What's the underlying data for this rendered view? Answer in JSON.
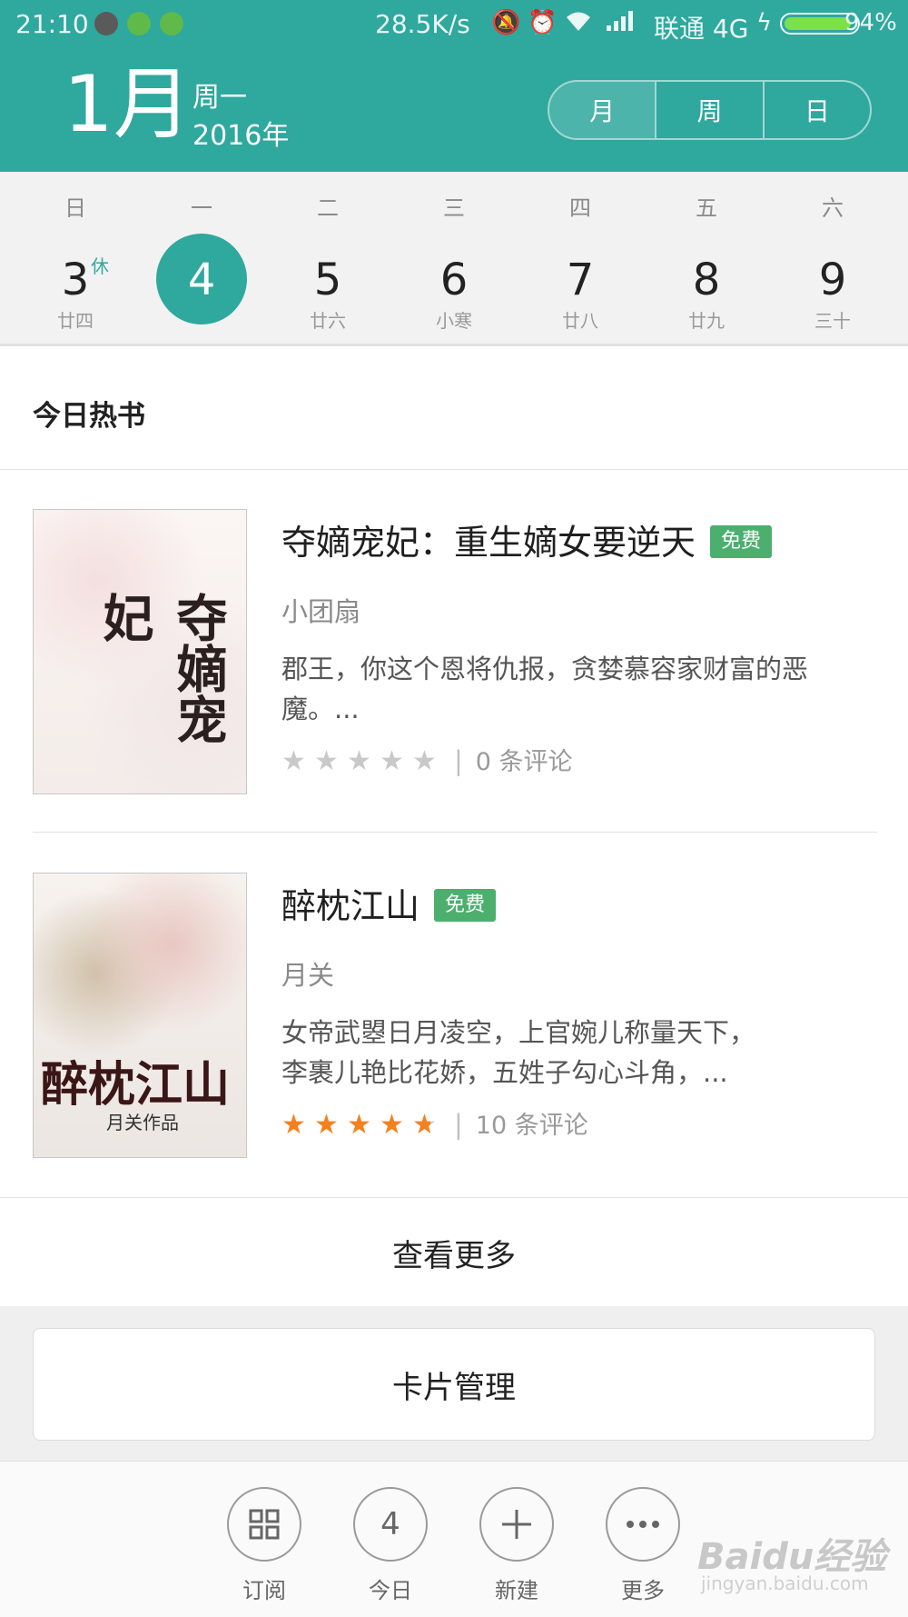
{
  "status_bar": {
    "time": "21:10",
    "speed": "28.5K/s",
    "carrier": "联通 4G",
    "battery": "94%",
    "battery_level": 0.94,
    "icons": [
      "mute-icon",
      "alarm-icon",
      "wifi-icon",
      "signal-icon",
      "charging-icon"
    ]
  },
  "header": {
    "month": "1月",
    "weekday": "周一",
    "year": "2016年",
    "view_tabs": [
      "月",
      "周",
      "日"
    ],
    "accent_color": "#2fa89e"
  },
  "week": {
    "weekday_labels": [
      "日",
      "一",
      "二",
      "三",
      "四",
      "五",
      "六"
    ],
    "days": [
      {
        "num": "3",
        "sub": "廿四",
        "tag": "休"
      },
      {
        "num": "4",
        "sub": "",
        "selected": true
      },
      {
        "num": "5",
        "sub": "廿六"
      },
      {
        "num": "6",
        "sub": "小寒"
      },
      {
        "num": "7",
        "sub": "廿八"
      },
      {
        "num": "8",
        "sub": "廿九"
      },
      {
        "num": "9",
        "sub": "三十"
      }
    ]
  },
  "hot_books": {
    "title": "今日热书",
    "items": [
      {
        "title": "夺嫡宠妃：重生嫡女要逆天",
        "badge": "免费",
        "author": "小团扇",
        "desc_line1": "郡王，你这个恩将仇报，贪婪慕容家财富的恶",
        "desc_line2": "魔。...",
        "rating": 0,
        "comments": "0 条评论",
        "cover_text": "夺嫡宠妃"
      },
      {
        "title": "醉枕江山",
        "badge": "免费",
        "author": "月关",
        "desc_line1": "女帝武曌日月凌空，上官婉儿称量天下，",
        "desc_line2": "李裹儿艳比花娇，五姓子勾心斗角，...",
        "rating": 4.5,
        "comments": "10 条评论",
        "cover_text": "醉枕江山",
        "cover_sub": "月关作品"
      }
    ],
    "more": "查看更多"
  },
  "card_manage": "卡片管理",
  "bottom_nav": [
    {
      "label": "订阅",
      "icon": "grid-icon"
    },
    {
      "label": "今日",
      "icon_text": "4"
    },
    {
      "label": "新建",
      "icon": "plus-icon"
    },
    {
      "label": "更多",
      "icon": "more-icon"
    }
  ],
  "watermark": {
    "main": "Baidu经验",
    "sub": "jingyan.baidu.com"
  }
}
